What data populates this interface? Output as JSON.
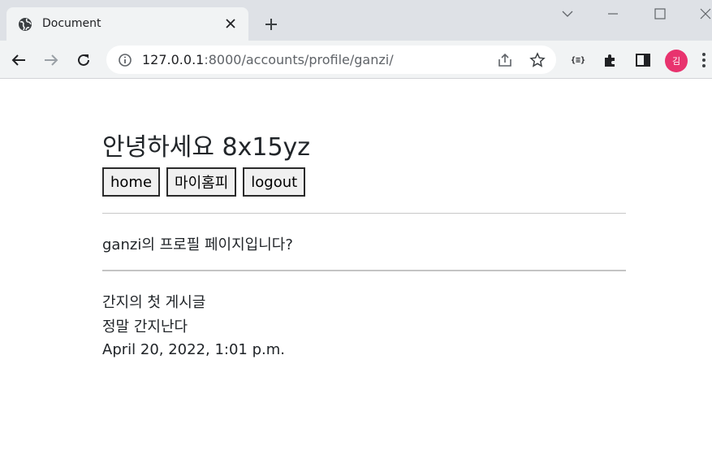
{
  "browser": {
    "tab_title": "Document",
    "url_host": "127.0.0.1",
    "url_rest": ":8000/accounts/profile/ganzi/",
    "avatar_initial": "김",
    "extension_label": "{≡}",
    "avatar_color": "#e8336e"
  },
  "page": {
    "greeting": "안녕하세요 8x15yz",
    "nav_buttons": {
      "home": "home",
      "my_homepage": "마이홈피",
      "logout": "logout"
    },
    "profile_text": "ganzi의 프로필 페이지입니다?",
    "post": {
      "title": "간지의 첫 게시글",
      "content": "정말 간지난다",
      "date": "April 20, 2022, 1:01 p.m."
    }
  }
}
